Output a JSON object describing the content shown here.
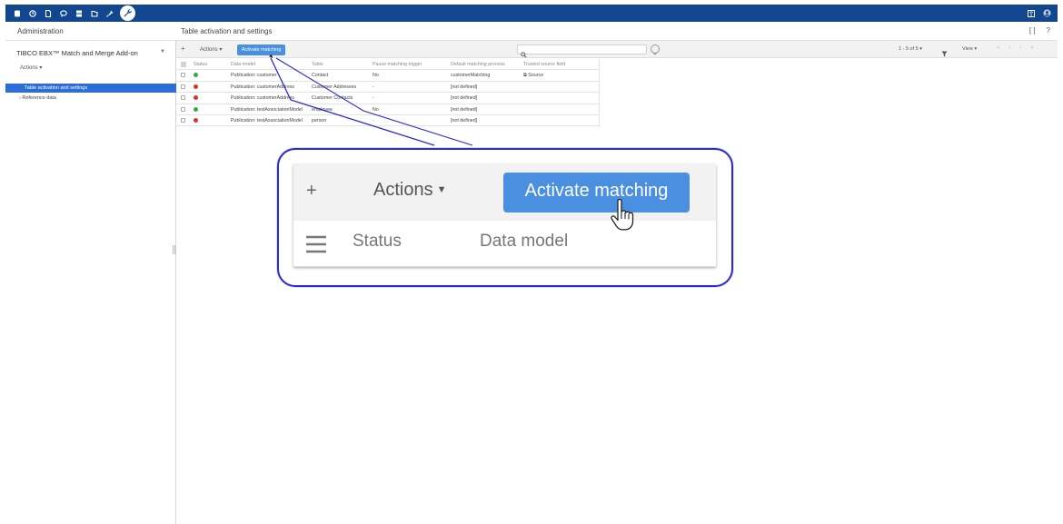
{
  "topbar": {
    "icons": [
      "database-icon",
      "clock-icon",
      "document-icon",
      "chat-icon",
      "layers-icon",
      "folder-icon",
      "pin-icon",
      "wrench-icon"
    ],
    "right_icons": [
      "book-icon",
      "user-icon"
    ]
  },
  "header": {
    "section": "Administration",
    "page_title": "Table activation and settings",
    "icons": [
      "expand-icon",
      "help-icon"
    ],
    "expand_label": "[ ]",
    "help_label": "?"
  },
  "sidebar": {
    "module": "TIBCO EBX™ Match and Merge Add-on",
    "module_caret": "▼",
    "actions_label": "Actions ▾",
    "items": [
      {
        "label": "Table activation and settings",
        "active": true
      },
      {
        "label": "› Reference data",
        "active": false
      }
    ]
  },
  "toolbar": {
    "plus": "+",
    "actions_label": "Actions ▾",
    "activate_label": "Activate matching",
    "search_placeholder": "",
    "paging": "1 - 5 of 5 ▾",
    "view_label": "View ▾",
    "nav_arrows": [
      "«",
      "‹",
      "›",
      "»"
    ]
  },
  "table": {
    "columns": [
      "Status",
      "Data model",
      "Table",
      "Pause matching trigger",
      "Default matching process",
      "Trusted source field"
    ],
    "rows": [
      {
        "status": "active",
        "data_model": "Publication: customer",
        "table": "Contact",
        "pause": "No",
        "process": "customerMatching",
        "trusted": "⧉ Source"
      },
      {
        "status": "inactive",
        "data_model": "Publication: customerAddress",
        "table": "Customer Addresses",
        "pause": "-",
        "process": "[not defined]",
        "trusted": ""
      },
      {
        "status": "inactive",
        "data_model": "Publication: customerAddress",
        "table": "Customer Contacts",
        "pause": "-",
        "process": "[not defined]",
        "trusted": ""
      },
      {
        "status": "active",
        "data_model": "Publication: testAssociationModel",
        "table": "employee",
        "pause": "No",
        "process": "[not defined]",
        "trusted": ""
      },
      {
        "status": "inactive",
        "data_model": "Publication: testAssociationModel",
        "table": "person",
        "pause": "-",
        "process": "[not defined]",
        "trusted": ""
      }
    ],
    "status_colors": {
      "active": "#3aa845",
      "inactive": "#d9342b"
    }
  },
  "callout": {
    "plus": "+",
    "actions_label": "Actions",
    "activate_label": "Activate matching",
    "col_status": "Status",
    "col_data_model": "Data model",
    "border_color": "#2a2bd4"
  },
  "colors": {
    "topbar": "#12478f",
    "accent": "#4a8fe0",
    "nav_active": "#2d6ed6"
  }
}
